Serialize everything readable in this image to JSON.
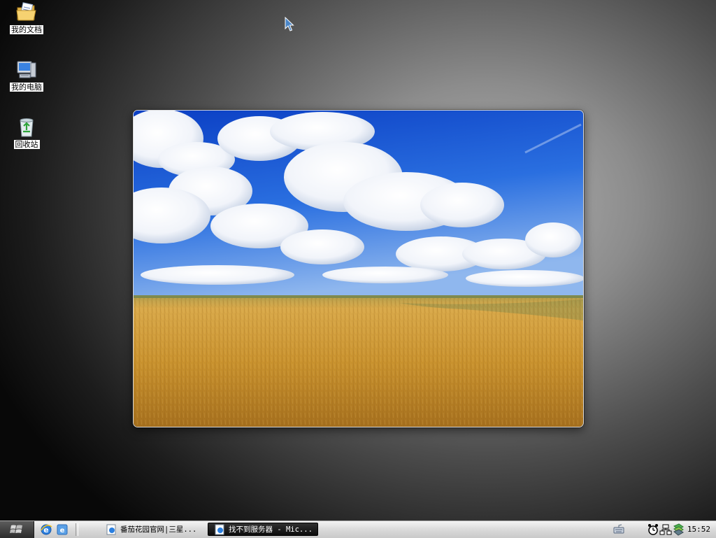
{
  "desktop": {
    "icons": [
      {
        "label": "我的文档",
        "icon": "folder-documents-icon"
      },
      {
        "label": "我的电脑",
        "icon": "computer-icon"
      },
      {
        "label": "回收站",
        "icon": "recycle-bin-icon"
      }
    ],
    "wallpaper": {
      "description_colors": {
        "sky": "#1f5fd8",
        "field": "#c9922e"
      }
    }
  },
  "taskbar": {
    "start_icon": "windows-logo-icon",
    "quick_launch": [
      "internet-explorer-icon",
      "show-desktop-icon"
    ],
    "tasks": [
      {
        "label": "番茄花园官网|三星...",
        "icon": "ie-page-icon",
        "active": false
      },
      {
        "label": "找不到服务器 - Mic...",
        "icon": "ie-page-icon",
        "active": true
      }
    ],
    "tray": [
      "keyboard-icon",
      "network-icon",
      "volume-icon",
      "security-icon"
    ],
    "clock": "15:52"
  },
  "colors": {
    "taskbar_light": "#f4f4f4",
    "active_task": "#1a1a1a"
  }
}
